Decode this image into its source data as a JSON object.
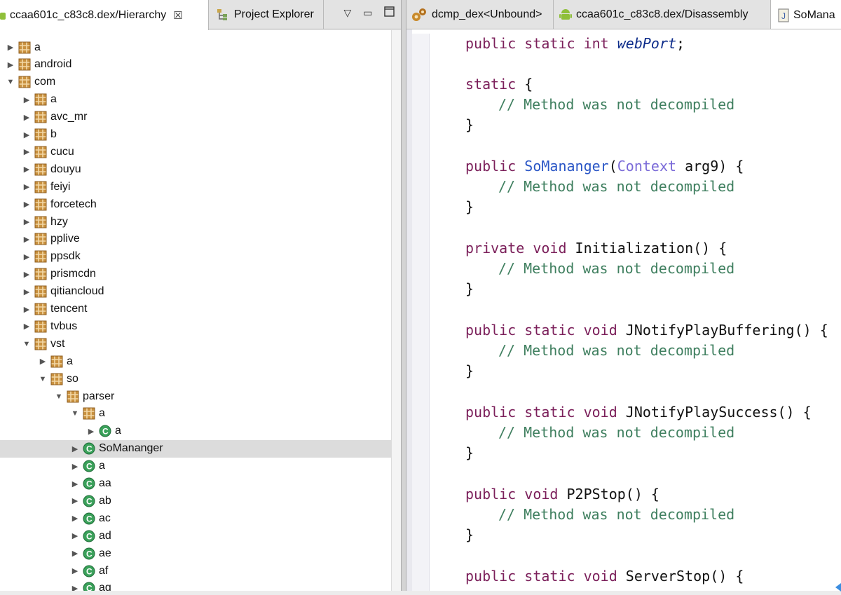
{
  "left_tabs": [
    {
      "label": "ccaa601c_c83c8.dex/Hierarchy",
      "icon": "android-icon",
      "active": true
    },
    {
      "label": "Project Explorer",
      "icon": "project-explorer-icon",
      "active": false
    }
  ],
  "right_tabs": [
    {
      "label": "dcmp_dex<Unbound>",
      "icon": "gears-icon"
    },
    {
      "label": "ccaa601c_c83c8.dex/Disassembly",
      "icon": "android-icon"
    },
    {
      "label": "SoMana",
      "icon": "java-file-icon"
    }
  ],
  "tree": [
    {
      "label": "a",
      "expanded": false,
      "type": "package"
    },
    {
      "label": "android",
      "expanded": false,
      "type": "package"
    },
    {
      "label": "com",
      "expanded": true,
      "type": "package"
    },
    {
      "label": "a",
      "expanded": false,
      "type": "package"
    },
    {
      "label": "avc_mr",
      "expanded": false,
      "type": "package"
    },
    {
      "label": "b",
      "expanded": false,
      "type": "package"
    },
    {
      "label": "cucu",
      "expanded": false,
      "type": "package"
    },
    {
      "label": "douyu",
      "expanded": false,
      "type": "package"
    },
    {
      "label": "feiyi",
      "expanded": false,
      "type": "package"
    },
    {
      "label": "forcetech",
      "expanded": false,
      "type": "package"
    },
    {
      "label": "hzy",
      "expanded": false,
      "type": "package"
    },
    {
      "label": "pplive",
      "expanded": false,
      "type": "package"
    },
    {
      "label": "ppsdk",
      "expanded": false,
      "type": "package"
    },
    {
      "label": "prismcdn",
      "expanded": false,
      "type": "package"
    },
    {
      "label": "qitiancloud",
      "expanded": false,
      "type": "package"
    },
    {
      "label": "tencent",
      "expanded": false,
      "type": "package"
    },
    {
      "label": "tvbus",
      "expanded": false,
      "type": "package"
    },
    {
      "label": "vst",
      "expanded": true,
      "type": "package"
    },
    {
      "label": "a",
      "expanded": false,
      "type": "package"
    },
    {
      "label": "so",
      "expanded": true,
      "type": "package"
    },
    {
      "label": "parser",
      "expanded": true,
      "type": "package"
    },
    {
      "label": "a",
      "expanded": true,
      "type": "package"
    },
    {
      "label": "a",
      "expanded": false,
      "type": "class"
    },
    {
      "label": "SoMananger",
      "expanded": false,
      "type": "class",
      "selected": true
    },
    {
      "label": "a",
      "expanded": false,
      "type": "class"
    },
    {
      "label": "aa",
      "expanded": false,
      "type": "class"
    },
    {
      "label": "ab",
      "expanded": false,
      "type": "class"
    },
    {
      "label": "ac",
      "expanded": false,
      "type": "class"
    },
    {
      "label": "ad",
      "expanded": false,
      "type": "class"
    },
    {
      "label": "ae",
      "expanded": false,
      "type": "class"
    },
    {
      "label": "af",
      "expanded": false,
      "type": "class"
    },
    {
      "label": "ag",
      "expanded": false,
      "type": "class"
    }
  ],
  "code": {
    "field_decl": {
      "kw": "public static int ",
      "name": "webPort",
      "tail": ";"
    },
    "static_block": {
      "kw": "static",
      "open": " {"
    },
    "comment": "// Method was not decompiled",
    "close_brace": "}",
    "constructor": {
      "kw": "public ",
      "name": "SoMananger",
      "paren": "(",
      "type": "Context",
      "arg": " arg9) {"
    },
    "methods": [
      {
        "kw": "private void ",
        "sig": "Initialization() {"
      },
      {
        "kw": "public static void ",
        "sig": "JNotifyPlayBuffering() {"
      },
      {
        "kw": "public static void ",
        "sig": "JNotifyPlaySuccess() {"
      },
      {
        "kw": "public void ",
        "sig": "P2PStop() {"
      },
      {
        "kw": "public static void ",
        "sig": "ServerStop() {"
      }
    ]
  }
}
